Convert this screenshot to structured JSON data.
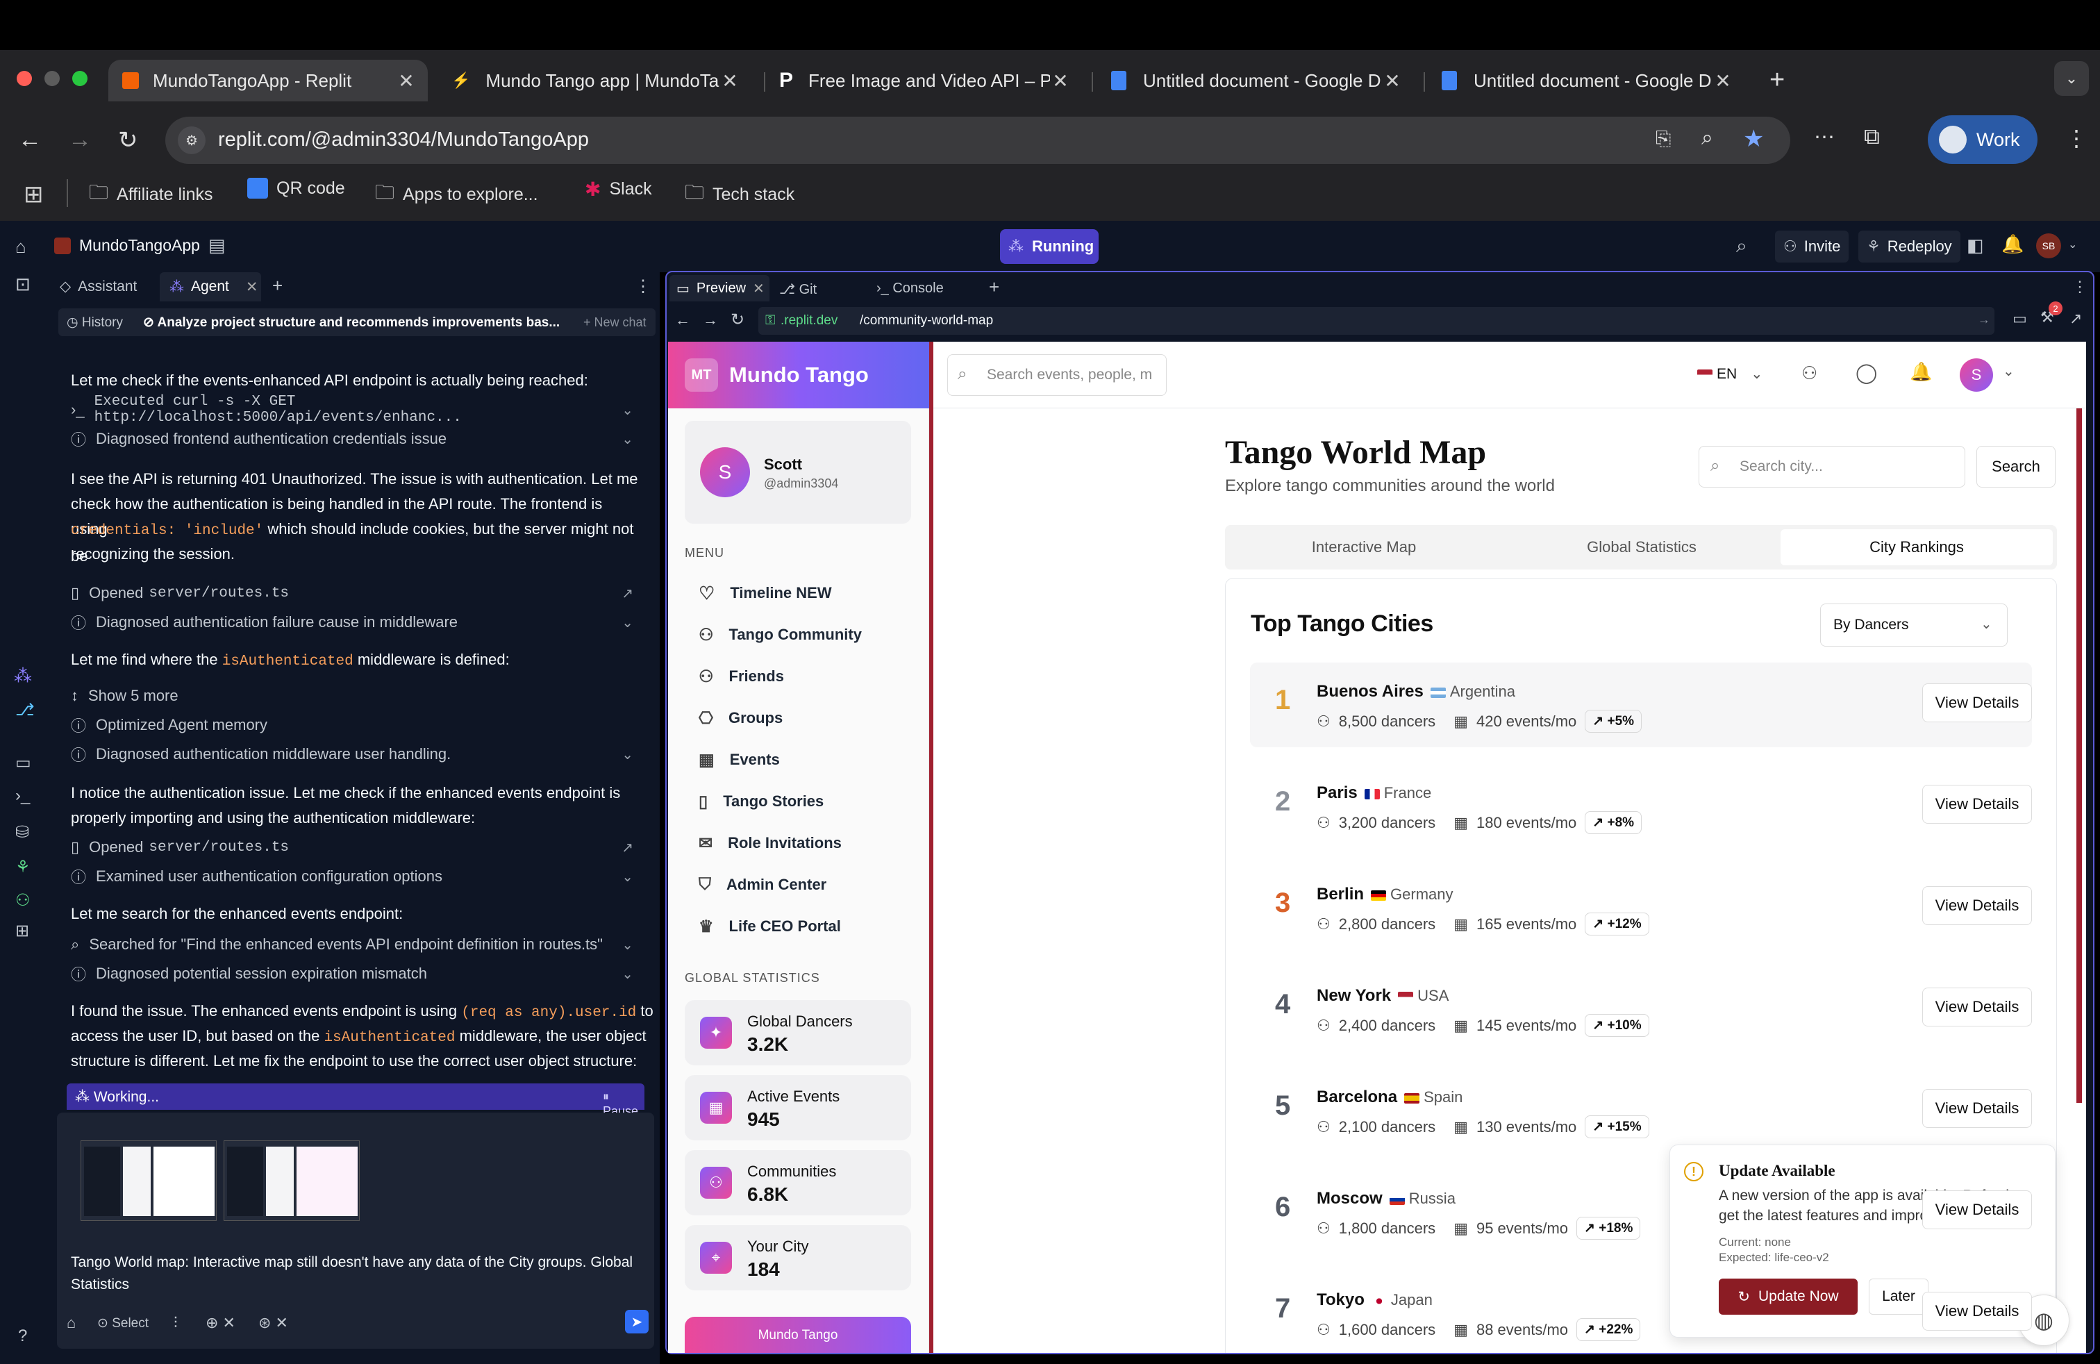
{
  "browser": {
    "tabs": [
      {
        "title": "MundoTangoApp - Replit",
        "active": true
      },
      {
        "title": "Mundo Tango app | MundoTan"
      },
      {
        "title": "Free Image and Video API – P"
      },
      {
        "title": "Untitled document - Google D"
      },
      {
        "title": "Untitled document - Google D"
      }
    ],
    "url": "replit.com/@admin3304/MundoTangoApp",
    "profile": "Work",
    "bookmarks": [
      "Affiliate links",
      "QR code",
      "Apps to explore...",
      "Slack",
      "Tech stack"
    ]
  },
  "replit": {
    "project": "MundoTangoApp",
    "status": "Running",
    "invite": "Invite",
    "redeploy": "Redeploy",
    "avatar": "SB",
    "notif_count": "2",
    "left_tabs": [
      "Assistant",
      "Agent"
    ],
    "chat_title": "Analyze project structure and recommends improvements bas...",
    "history": "History",
    "new_chat": "New chat",
    "working": "Working...",
    "pause": "Pause",
    "select": "Select",
    "input_text": "Tango World map: Interactive map still doesn't have any data of the City groups. Global Statistics",
    "right_tabs": [
      "Preview",
      "Git",
      "Console"
    ],
    "preview_url_host": ".replit.dev",
    "preview_url_path": "/community-world-map"
  },
  "chat": {
    "m1": "Let me check if the events-enhanced API endpoint is actually being reached:",
    "a1": "Executed curl -s -X GET http://localhost:5000/api/events/enhanc...",
    "a2": "Diagnosed frontend authentication credentials issue",
    "m2a": "I see the API is returning 401 Unauthorized. The issue is with authentication. Let me",
    "m2b": "check how the authentication is being handled in the API route. The frontend is using",
    "m2c_code": "credentials: 'include'",
    "m2c": "which should include cookies, but the server might not be",
    "m2d": "recognizing the session.",
    "a3_pre": "Opened",
    "a3_file": "server/routes.ts",
    "a4": "Diagnosed authentication failure cause in middleware",
    "m3_pre": "Let me find where the",
    "m3_code": "isAuthenticated",
    "m3_post": "middleware is defined:",
    "a5": "Show 5 more",
    "a6": "Optimized Agent memory",
    "a7": "Diagnosed authentication middleware user handling.",
    "m4a": "I notice the authentication issue. Let me check if the enhanced events endpoint is",
    "m4b": "properly importing and using the authentication middleware:",
    "a8_pre": "Opened",
    "a8_file": "server/routes.ts",
    "a9": "Examined user authentication configuration options",
    "m5": "Let me search for the enhanced events endpoint:",
    "a10": "Searched for \"Find the enhanced events API endpoint definition in routes.ts\"",
    "a11": "Diagnosed potential session expiration mismatch",
    "m6a_pre": "I found the issue. The enhanced events endpoint is using",
    "m6a_code": "(req as any).user.id",
    "m6a_post": "to",
    "m6b_pre": "access the user ID, but based on the",
    "m6b_code": "isAuthenticated",
    "m6b_post": "middleware, the user object",
    "m6c": "structure is different. Let me fix the endpoint to use the correct user object structure:"
  },
  "app": {
    "logo": "MT",
    "brand": "Mundo Tango",
    "user": {
      "initial": "S",
      "name": "Scott",
      "handle": "@admin3304"
    },
    "menu_label": "MENU",
    "menu": [
      "Timeline NEW",
      "Tango Community",
      "Friends",
      "Groups",
      "Events",
      "Tango Stories",
      "Role Invitations",
      "Admin Center",
      "Life CEO Portal"
    ],
    "global_stats_label": "GLOBAL STATISTICS",
    "stats": [
      {
        "label": "Global Dancers",
        "value": "3.2K"
      },
      {
        "label": "Active Events",
        "value": "945"
      },
      {
        "label": "Communities",
        "value": "6.8K"
      },
      {
        "label": "Your City",
        "value": "184"
      }
    ],
    "promo": "Mundo Tango",
    "search_placeholder": "Search events, people, m",
    "lang": "EN",
    "user_initial": "S",
    "page_title": "Tango World Map",
    "page_subtitle": "Explore tango communities around the world",
    "city_search_placeholder": "Search city...",
    "search_button": "Search",
    "tabs": [
      "Interactive Map",
      "Global Statistics",
      "City Rankings"
    ],
    "active_tab": "City Rankings",
    "card_title": "Top Tango Cities",
    "sort": "By Dancers",
    "view_details": "View Details",
    "cities": [
      {
        "rank": "1",
        "name": "Buenos Aires",
        "country": "Argentina",
        "dancers": "8,500 dancers",
        "events": "420 events/mo",
        "trend": "+5%",
        "rank_color": "#e0a33a"
      },
      {
        "rank": "2",
        "name": "Paris",
        "country": "France",
        "dancers": "3,200 dancers",
        "events": "180 events/mo",
        "trend": "+8%",
        "rank_color": "#8a8f98"
      },
      {
        "rank": "3",
        "name": "Berlin",
        "country": "Germany",
        "dancers": "2,800 dancers",
        "events": "165 events/mo",
        "trend": "+12%",
        "rank_color": "#d9622b"
      },
      {
        "rank": "4",
        "name": "New York",
        "country": "USA",
        "dancers": "2,400 dancers",
        "events": "145 events/mo",
        "trend": "+10%",
        "rank_color": "#555b66"
      },
      {
        "rank": "5",
        "name": "Barcelona",
        "country": "Spain",
        "dancers": "2,100 dancers",
        "events": "130 events/mo",
        "trend": "+15%",
        "rank_color": "#555b66"
      },
      {
        "rank": "6",
        "name": "Moscow",
        "country": "Russia",
        "dancers": "1,800 dancers",
        "events": "95 events/mo",
        "trend": "+18%",
        "rank_color": "#555b66"
      },
      {
        "rank": "7",
        "name": "Tokyo",
        "country": "Japan",
        "dancers": "1,600 dancers",
        "events": "88 events/mo",
        "trend": "+22%",
        "rank_color": "#555b66"
      }
    ],
    "update": {
      "title": "Update Available",
      "body1": "A new version of the app is available. Refresh to",
      "body2": "get the latest features and improvements.",
      "current": "Current: none",
      "expected": "Expected: life-ceo-v2",
      "now": "Update Now",
      "later": "Later"
    }
  },
  "colors": {
    "accent": "#5b5bd6",
    "brand": "#8b5cf6",
    "update_btn": "#8b1c24",
    "replit_bg": "#0e1525"
  }
}
